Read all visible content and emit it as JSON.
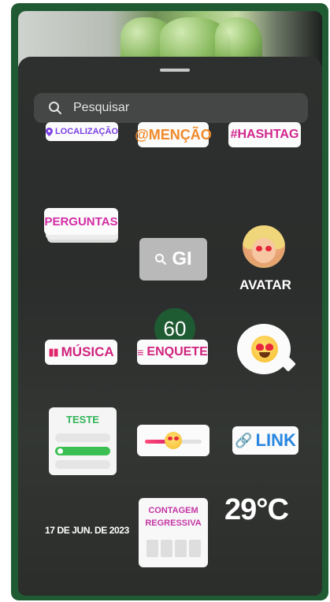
{
  "search": {
    "placeholder": "Pesquisar"
  },
  "stickers": {
    "location": "LOCALIZAÇÃO",
    "mention": "@MENÇÃO",
    "hashtag": "#HASHTAG",
    "questions": "PERGUNTAS",
    "gif": "GI",
    "avatar": "AVATAR",
    "music": "MÚSICA",
    "poll": "ENQUETE",
    "quiz_title": "TESTE",
    "slider_level": 0.5,
    "link": "LINK",
    "date": "17 DE JUN. DE 2023",
    "countdown_line1": "CONTAGEM",
    "countdown_line2": "REGRESSIVA",
    "temperature": "29°C"
  },
  "badge": {
    "number": "60"
  },
  "colors": {
    "frame_green": "#1f5a33",
    "location": "#7b3fe4",
    "mention": "#f08a2a",
    "hashtag": "#d2268e",
    "quiz_green": "#3bbf52",
    "link_blue": "#2a86e0"
  }
}
